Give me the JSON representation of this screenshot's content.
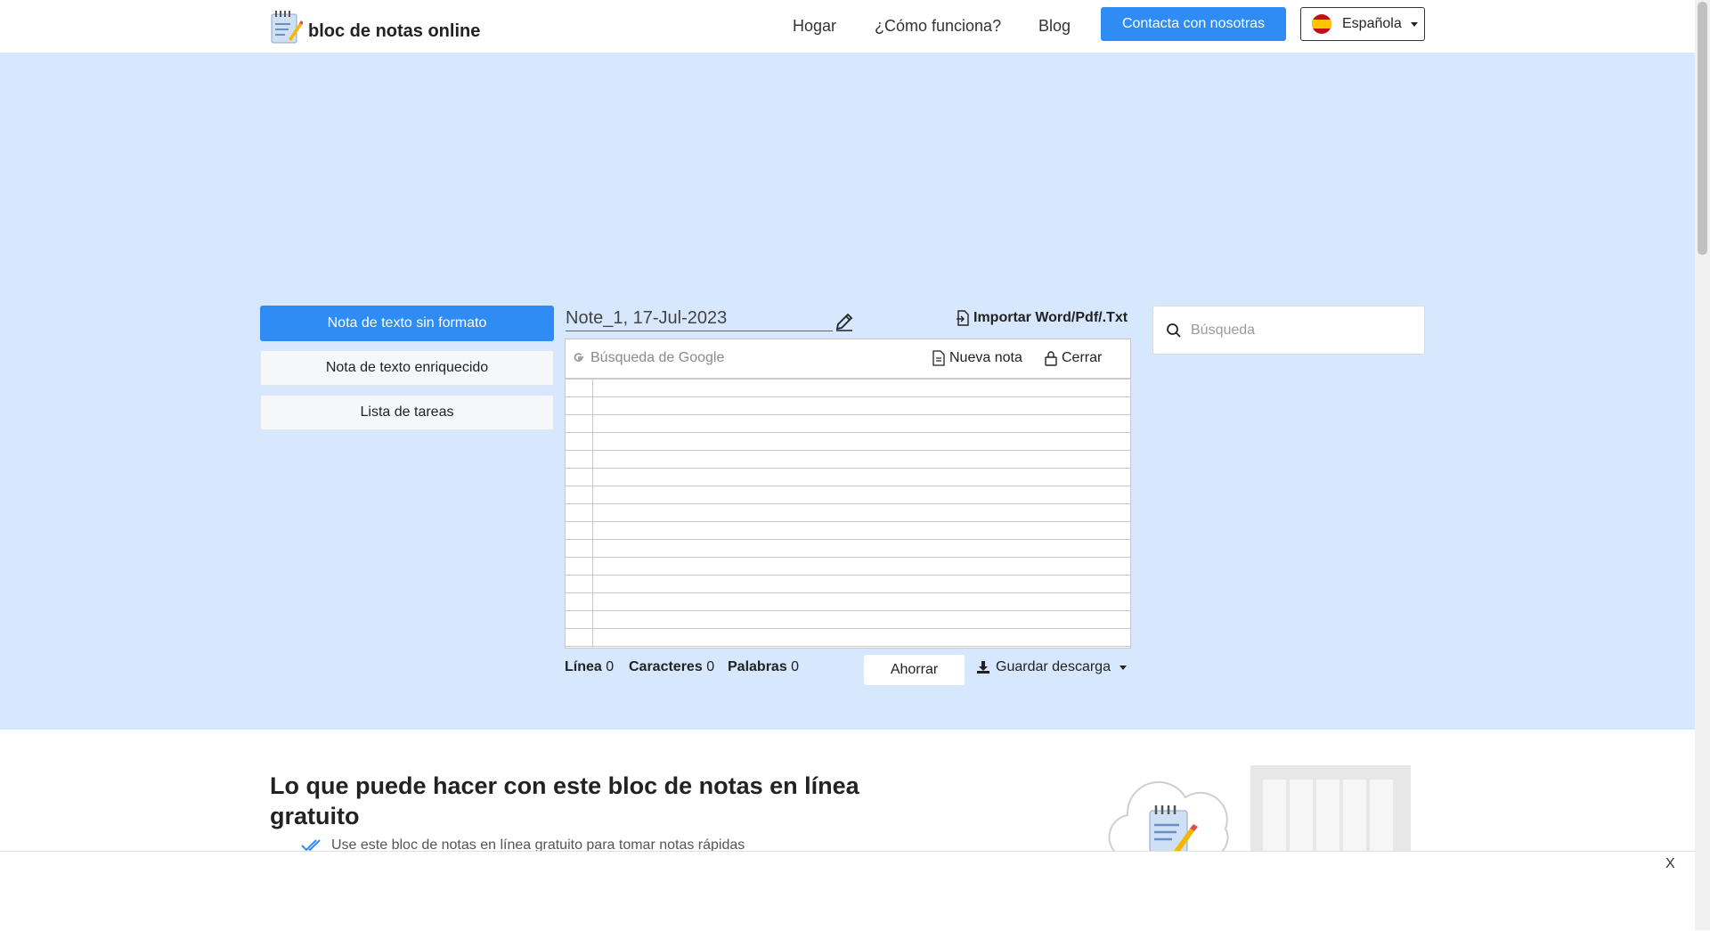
{
  "header": {
    "logo_text": "bloc de notas online",
    "nav": [
      "Hogar",
      "¿Cómo funciona?",
      "Blog"
    ],
    "contact_button": "Contacta con nosotras",
    "language": "Española"
  },
  "sidebar": {
    "items": [
      {
        "label": "Nota de texto sin formato",
        "active": true
      },
      {
        "label": "Nota de texto enriquecido",
        "active": false
      },
      {
        "label": "Lista de tareas",
        "active": false
      }
    ]
  },
  "editor": {
    "note_title": "Note_1, 17-Jul-2023",
    "import_label": "Importar Word/Pdf/.Txt",
    "google_search_placeholder": "Búsqueda de Google",
    "new_note_label": "Nueva nota",
    "close_label": "Cerrar",
    "content": ""
  },
  "stats": {
    "line_label": "Línea",
    "line_value": "0",
    "chars_label": "Caracteres",
    "chars_value": "0",
    "words_label": "Palabras",
    "words_value": "0"
  },
  "actions": {
    "save_label": "Ahorrar",
    "download_label": "Guardar descarga"
  },
  "search": {
    "placeholder": "Búsqueda"
  },
  "content": {
    "headline": "Lo que puede hacer con este bloc de notas en línea gratuito",
    "feature_1": "Use este bloc de notas en línea gratuito para tomar notas rápidas"
  },
  "ad": {
    "close_label": "X"
  },
  "colors": {
    "accent": "#2f8cf5",
    "background_blue": "#d6e7fe"
  }
}
